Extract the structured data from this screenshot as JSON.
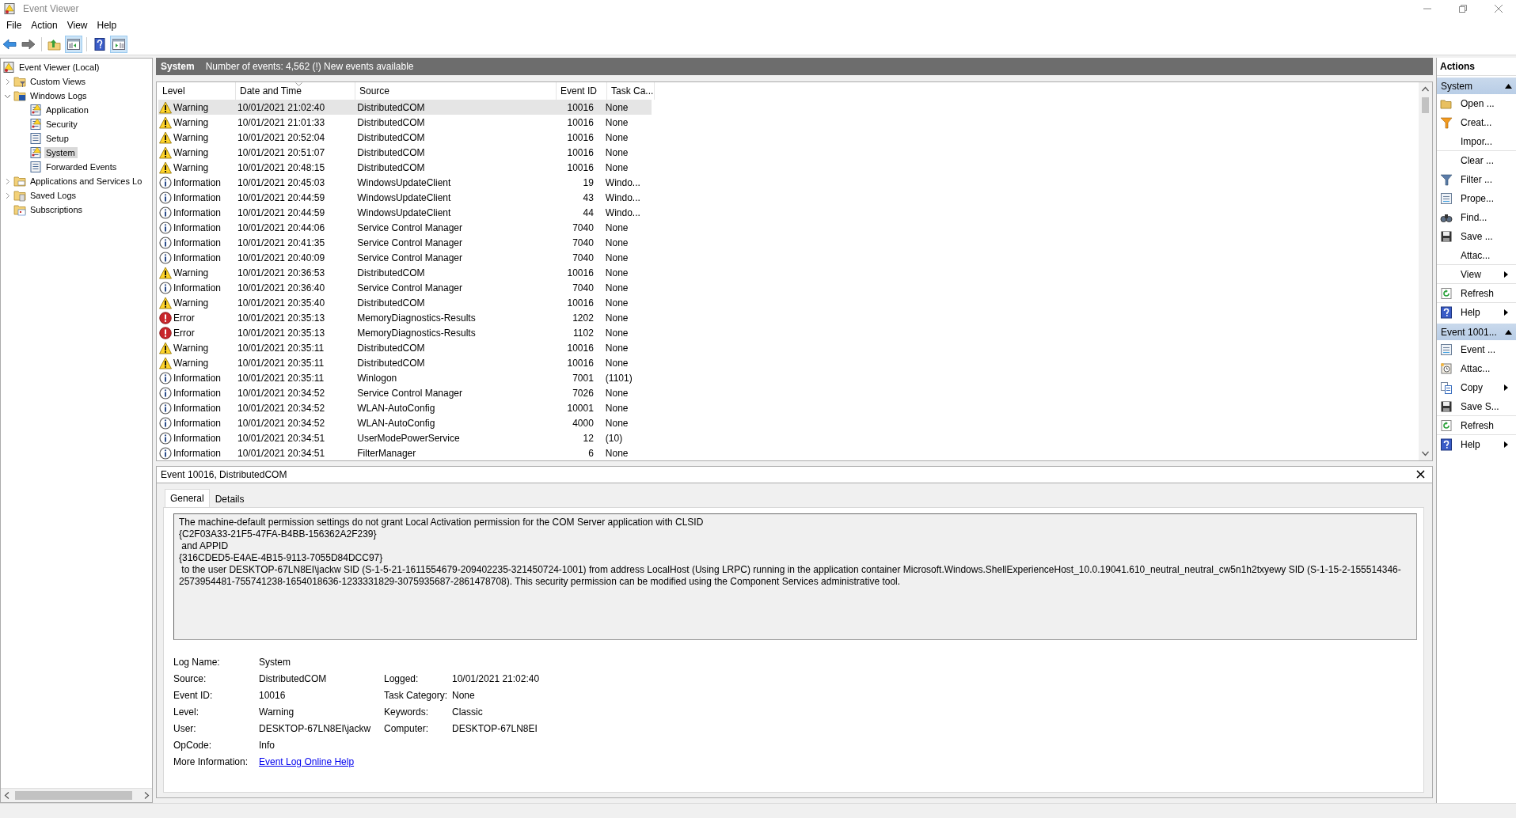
{
  "window": {
    "title": "Event Viewer"
  },
  "menu": [
    "File",
    "Action",
    "View",
    "Help"
  ],
  "toolbar": [
    {
      "kind": "back",
      "pressed": false
    },
    {
      "kind": "forward",
      "pressed": false
    },
    {
      "kind": "up",
      "pressed": false
    },
    {
      "kind": "tree-pane",
      "pressed": true
    },
    {
      "kind": "help",
      "pressed": false
    },
    {
      "kind": "action-pane",
      "pressed": true
    }
  ],
  "tree": [
    {
      "label": "Event Viewer (Local)",
      "kind": "root",
      "selected": false,
      "children": [
        {
          "label": "Custom Views",
          "kind": "folder-filter",
          "selected": false,
          "expanded": false
        },
        {
          "label": "Windows Logs",
          "kind": "folder-logs",
          "selected": false,
          "expanded": true,
          "children": [
            {
              "label": "Application",
              "kind": "log-alert",
              "selected": false
            },
            {
              "label": "Security",
              "kind": "log-alert",
              "selected": false
            },
            {
              "label": "Setup",
              "kind": "log",
              "selected": false
            },
            {
              "label": "System",
              "kind": "log-alert",
              "selected": true
            },
            {
              "label": "Forwarded Events",
              "kind": "log",
              "selected": false
            }
          ]
        },
        {
          "label": "Applications and Services Lo",
          "kind": "folder",
          "selected": false,
          "expanded": false
        },
        {
          "label": "Saved Logs",
          "kind": "folder-saved",
          "selected": false,
          "expanded": false
        },
        {
          "label": "Subscriptions",
          "kind": "folder-subs",
          "selected": false
        }
      ]
    }
  ],
  "log_header": {
    "title": "System",
    "summary": "Number of events: 4,562 (!) New events available"
  },
  "table": {
    "columns": [
      {
        "label": "Level",
        "sorted": false
      },
      {
        "label": "Date and Time",
        "sorted": true
      },
      {
        "label": "Source",
        "sorted": false
      },
      {
        "label": "Event ID",
        "sorted": false
      },
      {
        "label": "Task Ca...",
        "sorted": false
      }
    ],
    "rows": [
      {
        "kind": "warning",
        "level": "Warning",
        "date": "10/01/2021 21:02:40",
        "source": "DistributedCOM",
        "event_id": "10016",
        "task": "None",
        "selected": true
      },
      {
        "kind": "warning",
        "level": "Warning",
        "date": "10/01/2021 21:01:33",
        "source": "DistributedCOM",
        "event_id": "10016",
        "task": "None",
        "selected": false
      },
      {
        "kind": "warning",
        "level": "Warning",
        "date": "10/01/2021 20:52:04",
        "source": "DistributedCOM",
        "event_id": "10016",
        "task": "None",
        "selected": false
      },
      {
        "kind": "warning",
        "level": "Warning",
        "date": "10/01/2021 20:51:07",
        "source": "DistributedCOM",
        "event_id": "10016",
        "task": "None",
        "selected": false
      },
      {
        "kind": "warning",
        "level": "Warning",
        "date": "10/01/2021 20:48:15",
        "source": "DistributedCOM",
        "event_id": "10016",
        "task": "None",
        "selected": false
      },
      {
        "kind": "information",
        "level": "Information",
        "date": "10/01/2021 20:45:03",
        "source": "WindowsUpdateClient",
        "event_id": "19",
        "task": "Windo...",
        "selected": false
      },
      {
        "kind": "information",
        "level": "Information",
        "date": "10/01/2021 20:44:59",
        "source": "WindowsUpdateClient",
        "event_id": "43",
        "task": "Windo...",
        "selected": false
      },
      {
        "kind": "information",
        "level": "Information",
        "date": "10/01/2021 20:44:59",
        "source": "WindowsUpdateClient",
        "event_id": "44",
        "task": "Windo...",
        "selected": false
      },
      {
        "kind": "information",
        "level": "Information",
        "date": "10/01/2021 20:44:06",
        "source": "Service Control Manager",
        "event_id": "7040",
        "task": "None",
        "selected": false
      },
      {
        "kind": "information",
        "level": "Information",
        "date": "10/01/2021 20:41:35",
        "source": "Service Control Manager",
        "event_id": "7040",
        "task": "None",
        "selected": false
      },
      {
        "kind": "information",
        "level": "Information",
        "date": "10/01/2021 20:40:09",
        "source": "Service Control Manager",
        "event_id": "7040",
        "task": "None",
        "selected": false
      },
      {
        "kind": "warning",
        "level": "Warning",
        "date": "10/01/2021 20:36:53",
        "source": "DistributedCOM",
        "event_id": "10016",
        "task": "None",
        "selected": false
      },
      {
        "kind": "information",
        "level": "Information",
        "date": "10/01/2021 20:36:40",
        "source": "Service Control Manager",
        "event_id": "7040",
        "task": "None",
        "selected": false
      },
      {
        "kind": "warning",
        "level": "Warning",
        "date": "10/01/2021 20:35:40",
        "source": "DistributedCOM",
        "event_id": "10016",
        "task": "None",
        "selected": false
      },
      {
        "kind": "error",
        "level": "Error",
        "date": "10/01/2021 20:35:13",
        "source": "MemoryDiagnostics-Results",
        "event_id": "1202",
        "task": "None",
        "selected": false
      },
      {
        "kind": "error",
        "level": "Error",
        "date": "10/01/2021 20:35:13",
        "source": "MemoryDiagnostics-Results",
        "event_id": "1102",
        "task": "None",
        "selected": false
      },
      {
        "kind": "warning",
        "level": "Warning",
        "date": "10/01/2021 20:35:11",
        "source": "DistributedCOM",
        "event_id": "10016",
        "task": "None",
        "selected": false
      },
      {
        "kind": "warning",
        "level": "Warning",
        "date": "10/01/2021 20:35:11",
        "source": "DistributedCOM",
        "event_id": "10016",
        "task": "None",
        "selected": false
      },
      {
        "kind": "information",
        "level": "Information",
        "date": "10/01/2021 20:35:11",
        "source": "Winlogon",
        "event_id": "7001",
        "task": "(1101)",
        "selected": false
      },
      {
        "kind": "information",
        "level": "Information",
        "date": "10/01/2021 20:34:52",
        "source": "Service Control Manager",
        "event_id": "7026",
        "task": "None",
        "selected": false
      },
      {
        "kind": "information",
        "level": "Information",
        "date": "10/01/2021 20:34:52",
        "source": "WLAN-AutoConfig",
        "event_id": "10001",
        "task": "None",
        "selected": false
      },
      {
        "kind": "information",
        "level": "Information",
        "date": "10/01/2021 20:34:52",
        "source": "WLAN-AutoConfig",
        "event_id": "4000",
        "task": "None",
        "selected": false
      },
      {
        "kind": "information",
        "level": "Information",
        "date": "10/01/2021 20:34:51",
        "source": "UserModePowerService",
        "event_id": "12",
        "task": "(10)",
        "selected": false
      },
      {
        "kind": "information",
        "level": "Information",
        "date": "10/01/2021 20:34:51",
        "source": "FilterManager",
        "event_id": "6",
        "task": "None",
        "selected": false
      }
    ]
  },
  "detail": {
    "title": "Event 10016, DistributedCOM",
    "tabs": [
      {
        "label": "General",
        "selected": true
      },
      {
        "label": "Details",
        "selected": false
      }
    ],
    "description": "The machine-default permission settings do not grant Local Activation permission for the COM Server application with CLSID \n{C2F03A33-21F5-47FA-B4BB-156362A2F239}\n and APPID \n{316CDED5-E4AE-4B15-9113-7055D84DCC97}\n to the user DESKTOP-67LN8EI\\jackw SID (S-1-5-21-1611554679-209402235-321450724-1001) from address LocalHost (Using LRPC) running in the application container Microsoft.Windows.ShellExperienceHost_10.0.19041.610_neutral_neutral_cw5n1h2txyewy SID (S-1-15-2-155514346-2573954481-755741238-1654018636-1233331829-3075935687-2861478708). This security permission can be modified using the Component Services administrative tool.",
    "fields": [
      {
        "label": "Log Name:",
        "value": "System"
      },
      {
        "label": "Source:",
        "value": "DistributedCOM",
        "label_2": "Logged:",
        "value_2": "10/01/2021 21:02:40"
      },
      {
        "label": "Event ID:",
        "value": "10016",
        "label_2": "Task Category:",
        "value_2": "None"
      },
      {
        "label": "Level:",
        "value": "Warning",
        "label_2": "Keywords:",
        "value_2": "Classic"
      },
      {
        "label": "User:",
        "value": "DESKTOP-67LN8EI\\jackw",
        "label_2": "Computer:",
        "value_2": "DESKTOP-67LN8EI"
      },
      {
        "label": "OpCode:",
        "value": "Info"
      },
      {
        "label": "More Information:",
        "link": "Event Log Online Help"
      }
    ]
  },
  "actions": {
    "title": "Actions",
    "sections": [
      {
        "title": "System",
        "expanded": true,
        "items": [
          {
            "label": "Open ...",
            "kind": "open",
            "submenu": false,
            "divider_after": false
          },
          {
            "label": "Creat...",
            "kind": "filter-create",
            "submenu": false,
            "divider_after": false
          },
          {
            "label": "Impor...",
            "kind": "plain",
            "submenu": false,
            "divider_after": true
          },
          {
            "label": "Clear ...",
            "kind": "plain",
            "submenu": false,
            "divider_after": false
          },
          {
            "label": "Filter ...",
            "kind": "filter",
            "submenu": false,
            "divider_after": false
          },
          {
            "label": "Prope...",
            "kind": "properties",
            "submenu": false,
            "divider_after": false
          },
          {
            "label": "Find...",
            "kind": "find",
            "submenu": false,
            "divider_after": false
          },
          {
            "label": "Save ...",
            "kind": "save",
            "submenu": false,
            "divider_after": false
          },
          {
            "label": "Attac...",
            "kind": "plain",
            "submenu": false,
            "divider_after": true
          },
          {
            "label": "View",
            "kind": "plain",
            "submenu": true,
            "divider_after": true
          },
          {
            "label": "Refresh",
            "kind": "refresh",
            "submenu": false,
            "divider_after": true
          },
          {
            "label": "Help",
            "kind": "help",
            "submenu": true,
            "divider_after": false
          }
        ]
      },
      {
        "title": "Event 1001...",
        "expanded": true,
        "items": [
          {
            "label": "Event ...",
            "kind": "properties",
            "submenu": false,
            "divider_after": false
          },
          {
            "label": "Attac...",
            "kind": "task",
            "submenu": false,
            "divider_after": false
          },
          {
            "label": "Copy",
            "kind": "copy",
            "submenu": true,
            "divider_after": false
          },
          {
            "label": "Save S...",
            "kind": "save",
            "submenu": false,
            "divider_after": true
          },
          {
            "label": "Refresh",
            "kind": "refresh",
            "submenu": false,
            "divider_after": true
          },
          {
            "label": "Help",
            "kind": "help",
            "submenu": true,
            "divider_after": false
          }
        ]
      }
    ]
  }
}
